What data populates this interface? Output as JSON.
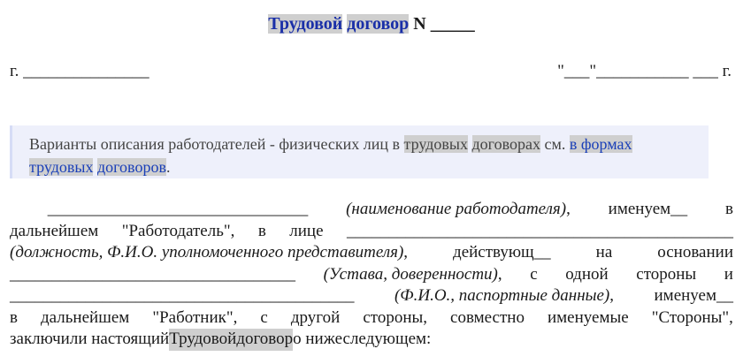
{
  "title": {
    "link_word_1": "Трудовой",
    "link_word_2": "договор",
    "suffix": "N _____"
  },
  "place_date": {
    "city": "г. _______________",
    "date": "\"___\"___________ ___ г."
  },
  "note": {
    "text_1": "Варианты описания работодателей - физических лиц в ",
    "hl_1": "трудовых",
    "space_1": " ",
    "hl_2": "договорах",
    "text_2": " см. ",
    "link_1": "в формах",
    "link_2": "трудовых",
    "space_2": " ",
    "link_3": "договоров",
    "end": "."
  },
  "body": {
    "line1": {
      "blank": "_______________________________",
      "italic": "(наименование работодателя)",
      "w1": ",",
      "w2": "именуем__",
      "w3": "в"
    },
    "line2": {
      "w1": "дальнейшем",
      "w2": "\"Работодатель\",",
      "w3": "в",
      "w4": "лице",
      "blank": "______________________________________________"
    },
    "line3": {
      "italic": "(должность, Ф.И.О. уполномоченного представителя)",
      "w1": ",",
      "w2": "действующ__",
      "w3": "на",
      "w4": "основании"
    },
    "line4": {
      "blank": "__________________________________",
      "italic": "(Устава, доверенности)",
      "w1": ",",
      "w2": "с",
      "w3": "одной",
      "w4": "стороны",
      "w5": "и"
    },
    "line5": {
      "blank": "_________________________________________",
      "italic": "(Ф.И.О., паспортные данные)",
      "w1": ",",
      "w2": "именуем__"
    },
    "line6": {
      "w1": "в",
      "w2": "дальнейшем",
      "w3": "\"Работник\",",
      "w4": "с",
      "w5": "другой",
      "w6": "стороны,",
      "w7": "совместно",
      "w8": "именуемые",
      "w9": "\"Стороны\","
    },
    "line7": {
      "pre": "заключили настоящий ",
      "hl_1": "Трудовой",
      "space": " ",
      "hl_2": "договор",
      "post": " о нижеследующем:"
    }
  }
}
